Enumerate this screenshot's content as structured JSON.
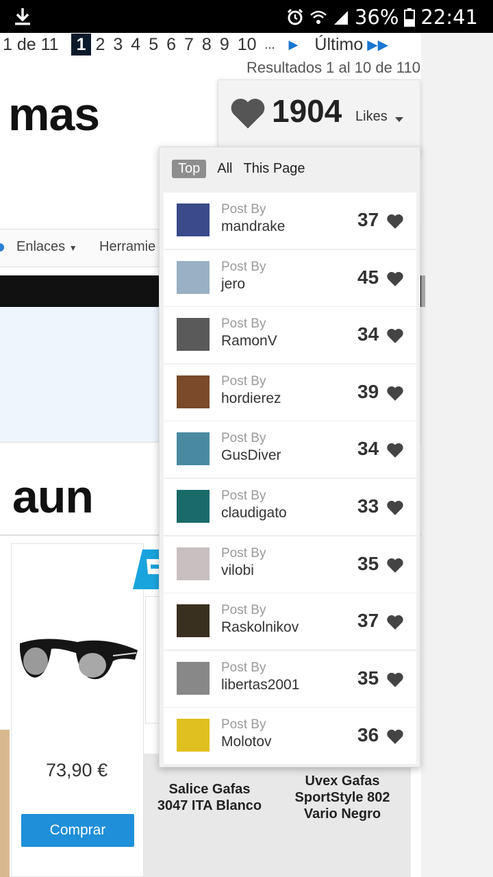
{
  "status_bar": {
    "battery": "36%",
    "time": "22:41"
  },
  "pagination": {
    "summary": "1 de 11",
    "current": "1",
    "pages": [
      "2",
      "3",
      "4",
      "5",
      "6",
      "7",
      "8",
      "9",
      "10"
    ],
    "ellipsis": "...",
    "last_label": "Último"
  },
  "results_text": "Resultados 1 al 10 de 110",
  "headline_fragments": {
    "first": "mas",
    "second": "aun"
  },
  "nav": {
    "links_label": "Enlaces",
    "tools_label": "Herramie"
  },
  "likes": {
    "count": "1904",
    "label": "Likes"
  },
  "likes_tabs": {
    "top": "Top",
    "all": "All",
    "this_page": "This Page"
  },
  "likes_list": [
    {
      "post_by": "Post By",
      "user": "mandrake",
      "likes": "37",
      "avatar_color": "#3a4a8a"
    },
    {
      "post_by": "Post By",
      "user": "jero",
      "likes": "45",
      "avatar_color": "#9ab0c4"
    },
    {
      "post_by": "Post By",
      "user": "RamonV",
      "likes": "34",
      "avatar_color": "#5a5a5a"
    },
    {
      "post_by": "Post By",
      "user": "hordierez",
      "likes": "39",
      "avatar_color": "#7a4a2a"
    },
    {
      "post_by": "Post By",
      "user": "GusDiver",
      "likes": "34",
      "avatar_color": "#4a8aa0"
    },
    {
      "post_by": "Post By",
      "user": "claudigato",
      "likes": "33",
      "avatar_color": "#1a6a6a"
    },
    {
      "post_by": "Post By",
      "user": "vilobi",
      "likes": "35",
      "avatar_color": "#c8c0c0"
    },
    {
      "post_by": "Post By",
      "user": "Raskolnikov",
      "likes": "37",
      "avatar_color": "#3a3020"
    },
    {
      "post_by": "Post By",
      "user": "libertas2001",
      "likes": "35",
      "avatar_color": "#888888"
    },
    {
      "post_by": "Post By",
      "user": "Molotov",
      "likes": "36",
      "avatar_color": "#e0c020"
    }
  ],
  "products": [
    {
      "price": "73,90 €",
      "buy_label": "Comprar"
    },
    {
      "name": "Salice Gafas 3047 ITA Blanco"
    },
    {
      "name": "Uvex Gafas SportStyle 802 Vario Negro"
    }
  ],
  "colors": {
    "buy_button": "#1e8fd8",
    "pagination_active": "#0b1a2a",
    "accent_link": "#1976d2"
  }
}
